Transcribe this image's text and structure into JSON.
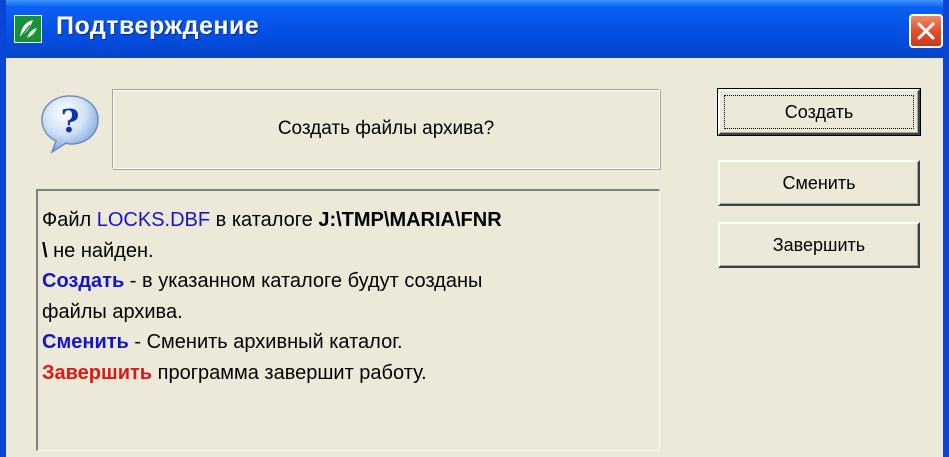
{
  "window": {
    "title": "Подтверждение",
    "app_icon": "app-leaf-icon",
    "close_icon": "close-icon",
    "titlebar_color": "#0553e6",
    "close_color": "#e2502e"
  },
  "message": {
    "icon": "question-icon",
    "text": "Создать файлы архива?"
  },
  "info": {
    "line1_prefix": "Файл ",
    "file_name": "LOCKS.DBF",
    "line1_middle": " в каталоге ",
    "path_part1": "J:\\TMP\\MARIA\\FNR",
    "path_part2": "\\",
    "line2_suffix": " не найден.",
    "create_kw": "Создать",
    "create_desc1": " - в указанном каталоге будут созданы",
    "create_desc2": "файлы архива.",
    "change_kw": "Сменить",
    "change_desc": " - Сменить архивный каталог.",
    "exit_kw": "Завершить",
    "exit_desc": " программа завершит работу.",
    "colors": {
      "blue": "#1515c8",
      "red": "#e01818"
    }
  },
  "buttons": {
    "create": "Создать",
    "change": "Сменить",
    "exit": "Завершить"
  }
}
